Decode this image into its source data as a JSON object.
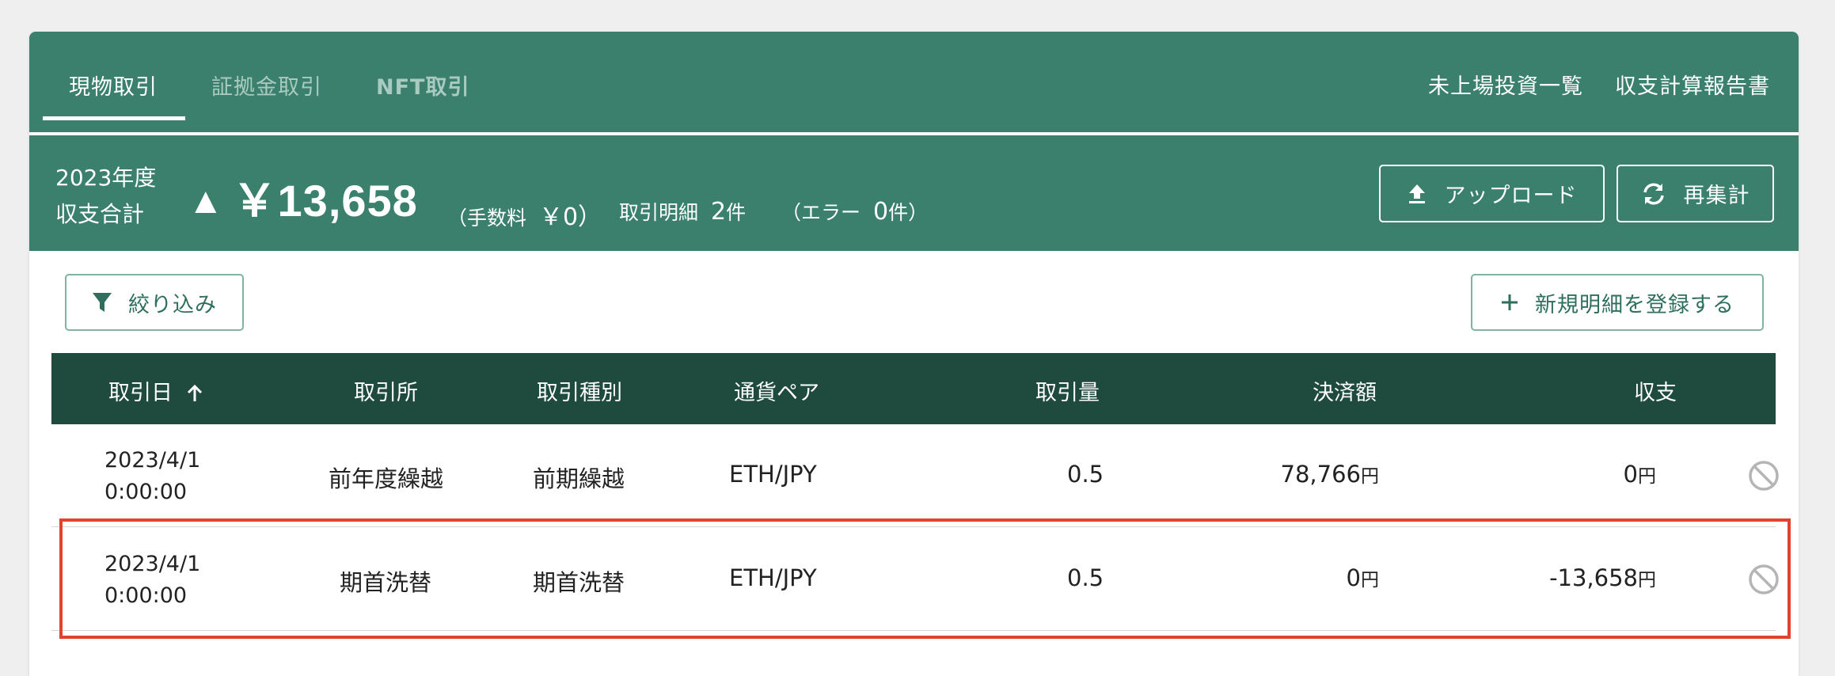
{
  "tabs": [
    {
      "label": "現物取引",
      "active": true
    },
    {
      "label": "証拠金取引",
      "active": false
    },
    {
      "label": "NFT取引",
      "active": false
    }
  ],
  "links": {
    "unlisted": "未上場投資一覧",
    "report": "収支計算報告書"
  },
  "summary": {
    "year": "2023年度",
    "label": "収支合計",
    "arrow": "▲",
    "total": "￥13,658",
    "fee_label": "（手数料",
    "fee_value": "￥0）",
    "count_label": "取引明細",
    "count_value": "2",
    "count_unit": "件",
    "error_label": "（エラー",
    "error_value": "0",
    "error_unit": "件）",
    "upload_label": "アップロード",
    "recalc_label": "再集計"
  },
  "actions": {
    "filter_label": "絞り込み",
    "new_label": "新規明細を登録する"
  },
  "table": {
    "columns": [
      "取引日",
      "取引所",
      "取引種別",
      "通貨ペア",
      "取引量",
      "決済額",
      "収支"
    ],
    "sort_indicator": "↑",
    "unit": "円",
    "rows": [
      {
        "date": "2023/4/1",
        "time": "0:00:00",
        "exchange": "前年度繰越",
        "type": "前期繰越",
        "pair": "ETH/JPY",
        "amount": "0.5",
        "settlement": "78,766",
        "pnl": "0"
      },
      {
        "date": "2023/4/1",
        "time": "0:00:00",
        "exchange": "期首洗替",
        "type": "期首洗替",
        "pair": "ETH/JPY",
        "amount": "0.5",
        "settlement": "0",
        "pnl": "-13,658"
      }
    ]
  },
  "colors": {
    "header_green": "#3a806d",
    "table_header": "#1f4a3e",
    "highlight": "#e0432e"
  },
  "icons": {
    "upload": "upload-icon",
    "recalc": "refresh-icon",
    "filter": "filter-icon",
    "add": "plus-icon",
    "sort": "arrow-up-icon",
    "disable": "ban-icon"
  }
}
